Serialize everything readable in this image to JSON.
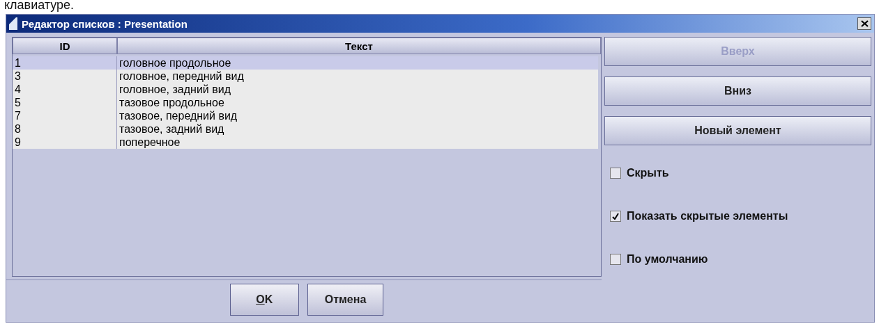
{
  "caption": "клавиатуре.",
  "window": {
    "title": "Редактор списков : Presentation"
  },
  "table": {
    "columns": [
      "ID",
      "Текст"
    ],
    "rows": [
      {
        "id": "1",
        "text": "головное продольное",
        "selected": true
      },
      {
        "id": "3",
        "text": "головное, передний вид",
        "selected": false
      },
      {
        "id": "4",
        "text": "головное, задний вид",
        "selected": false
      },
      {
        "id": "5",
        "text": "тазовое продольное",
        "selected": false
      },
      {
        "id": "7",
        "text": "тазовое, передний вид",
        "selected": false
      },
      {
        "id": "8",
        "text": "тазовое, задний вид",
        "selected": false
      },
      {
        "id": "9",
        "text": "поперечное",
        "selected": false
      }
    ]
  },
  "side_buttons": [
    {
      "label": "Вверх",
      "disabled": true
    },
    {
      "label": "Вниз",
      "disabled": false
    },
    {
      "label": "Новый элемент",
      "disabled": false
    }
  ],
  "options": [
    {
      "label": "Скрыть",
      "checked": false
    },
    {
      "label": "Показать скрытые элементы",
      "checked": true
    },
    {
      "label": "По умолчанию",
      "checked": false
    }
  ],
  "footer_buttons": [
    {
      "label": "OK",
      "mnemonic": true
    },
    {
      "label": "Отмена",
      "mnemonic": false
    }
  ]
}
